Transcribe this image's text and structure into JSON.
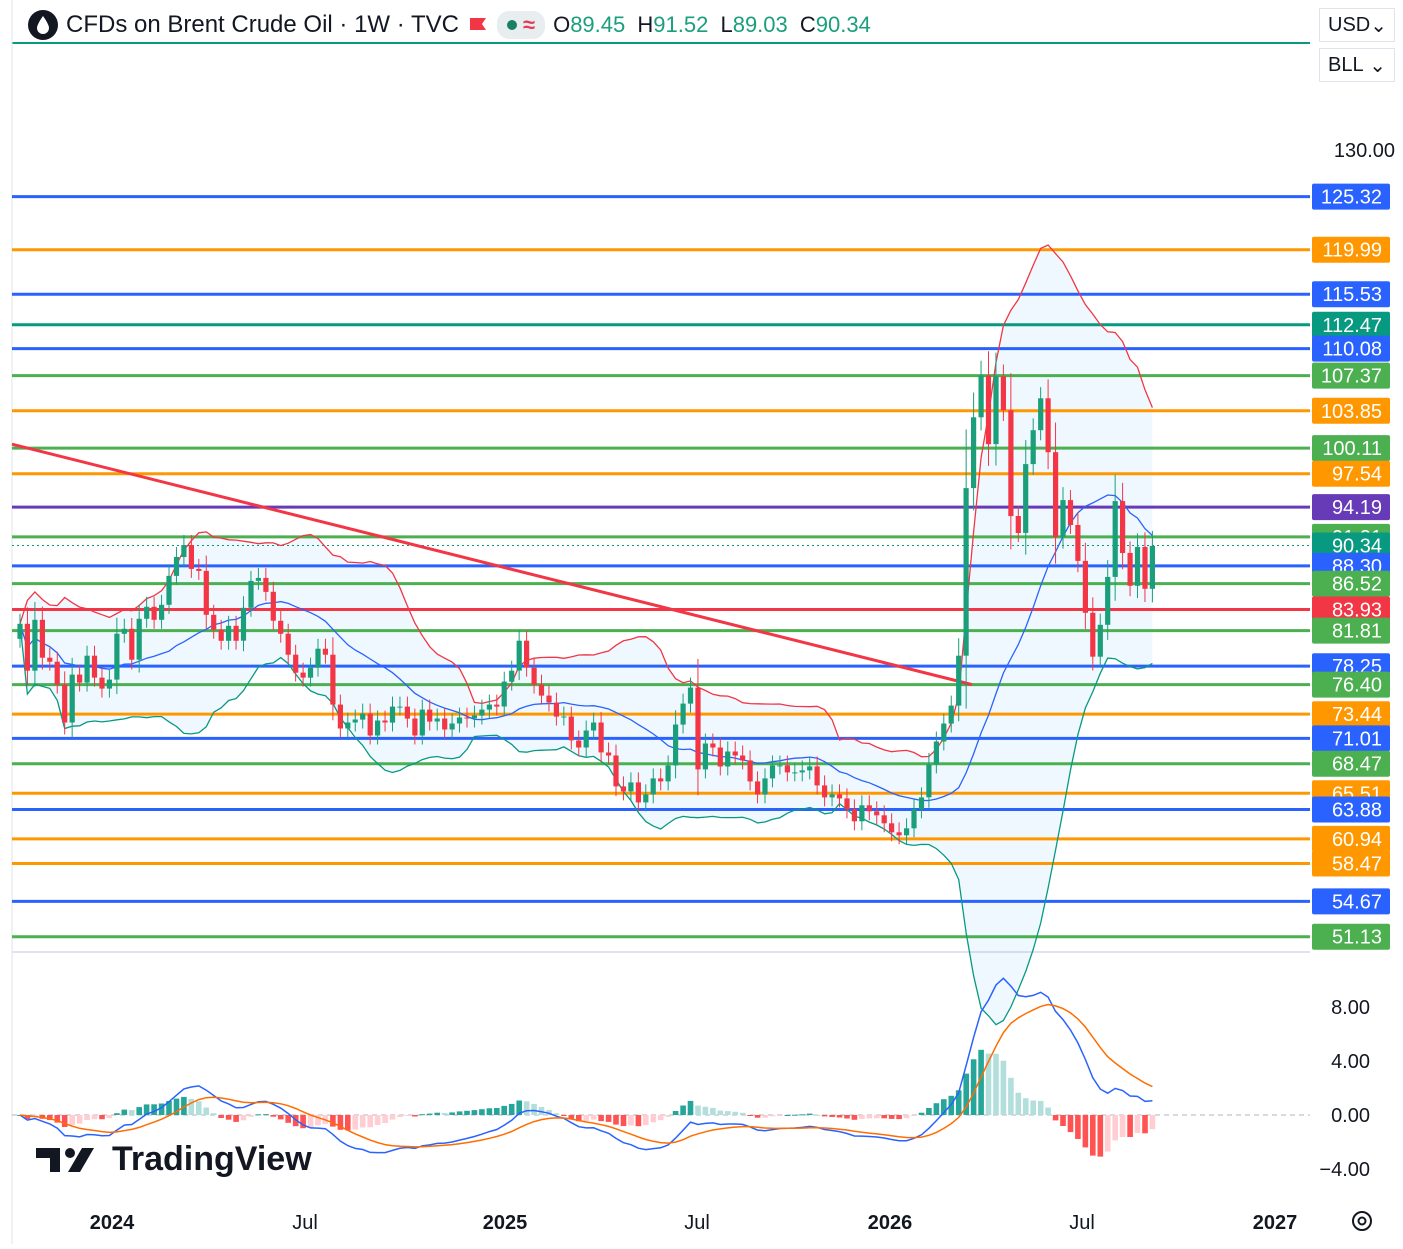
{
  "header": {
    "title": "CFDs on Brent Crude Oil · 1W · TVC",
    "ohlc": [
      {
        "k": "O",
        "v": "89.45"
      },
      {
        "k": "H",
        "v": "91.52"
      },
      {
        "k": "L",
        "v": "89.03"
      },
      {
        "k": "C",
        "v": "90.34"
      }
    ]
  },
  "controls": {
    "currency": "USD",
    "unit": "BLL"
  },
  "brand": "TradingView",
  "colors": {
    "up": "#1a9f7a",
    "down": "#f23645",
    "blue": "#2962ff",
    "orange": "#ff9800",
    "green": "#4caf50",
    "teal": "#089981",
    "purple": "#673ab7",
    "trend": "#f23645",
    "band_fill": "rgba(33,150,243,0.07)"
  },
  "chart_data": [
    {
      "type": "candlestick",
      "title": "CFDs on Brent Crude Oil · 1W · TVC",
      "price_axis": {
        "ylim": [
          50,
          135
        ],
        "ticks": [
          "130.00"
        ]
      },
      "time_axis": {
        "labels": [
          "2024",
          "Jul",
          "2025",
          "Jul",
          "2026",
          "Jul",
          "2027"
        ]
      },
      "last_price": 90.34,
      "horizontal_levels": [
        {
          "label": "125.32",
          "value": 125.32,
          "color": "blue"
        },
        {
          "label": "119.99",
          "value": 119.99,
          "color": "orange"
        },
        {
          "label": "115.53",
          "value": 115.53,
          "color": "blue"
        },
        {
          "label": "112.47",
          "value": 112.47,
          "color": "teal"
        },
        {
          "label": "110.08",
          "value": 110.08,
          "color": "blue"
        },
        {
          "label": "107.37",
          "value": 107.37,
          "color": "green"
        },
        {
          "label": "103.85",
          "value": 103.85,
          "color": "orange"
        },
        {
          "label": "100.11",
          "value": 100.11,
          "color": "green"
        },
        {
          "label": "97.54",
          "value": 97.54,
          "color": "orange"
        },
        {
          "label": "94.19",
          "value": 94.19,
          "color": "purple"
        },
        {
          "label": "91.21",
          "value": 91.21,
          "color": "green"
        },
        {
          "label": "90.34",
          "value": 90.34,
          "color": "teal"
        },
        {
          "label": "88.30",
          "value": 88.3,
          "color": "blue"
        },
        {
          "label": "86.52",
          "value": 86.52,
          "color": "green"
        },
        {
          "label": "83.93",
          "value": 83.93,
          "color": "red"
        },
        {
          "label": "81.81",
          "value": 81.81,
          "color": "green"
        },
        {
          "label": "78.25",
          "value": 78.25,
          "color": "blue"
        },
        {
          "label": "76.40",
          "value": 76.4,
          "color": "green"
        },
        {
          "label": "73.44",
          "value": 73.44,
          "color": "orange"
        },
        {
          "label": "71.01",
          "value": 71.01,
          "color": "blue"
        },
        {
          "label": "68.47",
          "value": 68.47,
          "color": "green"
        },
        {
          "label": "65.51",
          "value": 65.51,
          "color": "orange"
        },
        {
          "label": "63.88",
          "value": 63.88,
          "color": "blue"
        },
        {
          "label": "60.94",
          "value": 60.94,
          "color": "orange"
        },
        {
          "label": "58.47",
          "value": 58.47,
          "color": "orange"
        },
        {
          "label": "54.67",
          "value": 54.67,
          "color": "blue"
        },
        {
          "label": "51.13",
          "value": 51.13,
          "color": "green"
        }
      ],
      "closes": [
        82.5,
        77.8,
        82.9,
        79.1,
        78.7,
        76.4,
        72.6,
        77.4,
        76.6,
        79.3,
        77.1,
        76.0,
        76.9,
        81.5,
        82.0,
        78.9,
        83.0,
        84.2,
        82.9,
        84.4,
        87.3,
        89.2,
        90.4,
        88.0,
        87.8,
        83.4,
        81.9,
        80.8,
        82.3,
        80.8,
        84.1,
        86.8,
        87.1,
        85.7,
        82.8,
        81.5,
        79.4,
        77.6,
        77.1,
        78.1,
        80.0,
        79.4,
        74.4,
        72.0,
        72.6,
        72.9,
        73.5,
        71.3,
        72.8,
        72.6,
        74.2,
        74.2,
        73.0,
        71.3,
        73.9,
        72.7,
        73.0,
        71.9,
        72.5,
        73.1,
        73.0,
        73.3,
        73.9,
        74.4,
        74.2,
        76.7,
        77.8,
        80.8,
        78.1,
        76.4,
        75.3,
        74.6,
        73.2,
        73.2,
        70.8,
        70.1,
        71.8,
        72.6,
        69.6,
        69.3,
        66.2,
        65.7,
        66.6,
        64.6,
        65.4,
        67.0,
        66.7,
        68.3,
        72.4,
        74.5,
        76.1,
        67.9,
        70.5,
        70.1,
        68.2,
        69.7,
        69.3,
        68.8,
        66.7,
        65.4,
        67.0,
        68.3,
        68.3,
        67.6,
        67.6,
        67.8,
        68.2,
        66.3,
        65.1,
        65.4,
        65.0,
        63.9,
        62.7,
        64.3,
        63.7,
        63.3,
        62.5,
        61.6,
        61.3,
        62.0,
        63.9,
        65.1,
        68.4,
        70.7,
        72.5,
        74.3,
        79.3,
        96.1,
        103.2,
        107.4,
        100.5,
        107.3,
        103.9,
        93.3,
        91.6,
        98.5,
        101.9,
        105.1,
        99.7,
        91.2,
        94.9,
        92.4,
        88.8,
        83.6,
        79.2,
        82.4,
        87.2,
        94.8,
        89.6,
        86.3,
        90.2,
        86.0,
        90.3
      ],
      "indicators": {
        "bollinger": {
          "period": 20,
          "stddev": 2
        },
        "macd": {
          "fast": 12,
          "slow": 26,
          "signal": 9,
          "axis_ticks": [
            "8.00",
            "4.00",
            "0.00",
            "−4.00"
          ]
        }
      }
    }
  ]
}
